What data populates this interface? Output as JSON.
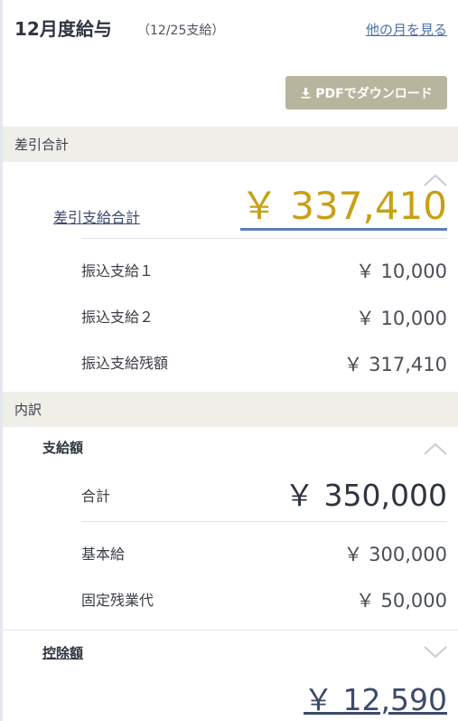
{
  "header": {
    "title": "12月度給与",
    "subtitle": "（12/25支給）",
    "other_month_link": "他の月を見る"
  },
  "toolbar": {
    "pdf_download_label": "PDFでダウンロード",
    "pdf_icon": "download-icon"
  },
  "net_pay": {
    "section_title": "差引合計",
    "label": "差引支給合計",
    "amount": "￥ 337,410",
    "collapse_icon": "chevron-up-icon",
    "rows": [
      {
        "label": "振込支給１",
        "value": "￥ 10,000"
      },
      {
        "label": "振込支給２",
        "value": "￥ 10,000"
      },
      {
        "label": "振込支給残額",
        "value": "￥ 317,410"
      }
    ]
  },
  "breakdown": {
    "section_title": "内訳",
    "payments": {
      "title": "支給額",
      "collapse_icon": "chevron-up-icon",
      "total_label": "合計",
      "total_value": "￥ 350,000",
      "rows": [
        {
          "label": "基本給",
          "value": "￥ 300,000"
        },
        {
          "label": "固定残業代",
          "value": "￥ 50,000"
        }
      ]
    },
    "deductions": {
      "title": "控除額",
      "expand_icon": "chevron-down-icon",
      "amount": "￥ 12,590"
    }
  },
  "colors": {
    "accent_gold": "#c8a013",
    "link_blue": "#4a6fa5",
    "button_khaki": "#b8b59e",
    "section_bg": "#efeee9"
  }
}
